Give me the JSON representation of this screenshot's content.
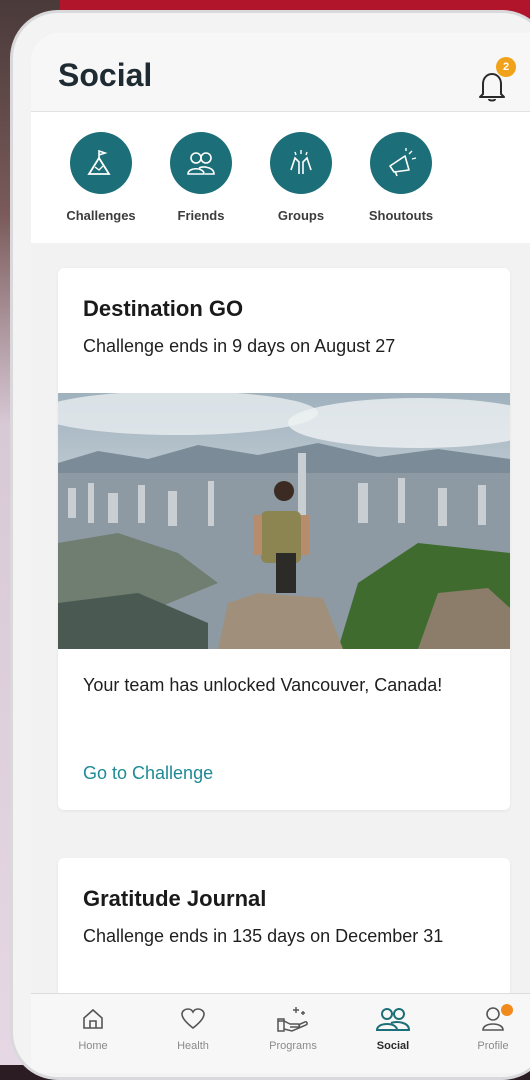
{
  "header": {
    "title": "Social",
    "notification_count": "2"
  },
  "quick_actions": [
    {
      "label": "Challenges",
      "icon": "mountain-flag-icon"
    },
    {
      "label": "Friends",
      "icon": "friends-icon"
    },
    {
      "label": "Groups",
      "icon": "high-five-icon"
    },
    {
      "label": "Shoutouts",
      "icon": "megaphone-icon"
    }
  ],
  "cards": [
    {
      "title": "Destination GO",
      "subtitle": "Challenge ends in 9 days on August 27",
      "body": "Your team has unlocked Vancouver, Canada!",
      "link": "Go to Challenge"
    },
    {
      "title": "Gratitude Journal",
      "subtitle": "Challenge ends in 135 days on December 31"
    }
  ],
  "tabs": [
    {
      "label": "Home",
      "icon": "home-icon"
    },
    {
      "label": "Health",
      "icon": "heart-icon"
    },
    {
      "label": "Programs",
      "icon": "hand-sparkle-icon"
    },
    {
      "label": "Social",
      "icon": "people-icon",
      "active": true
    },
    {
      "label": "Profile",
      "icon": "person-icon"
    }
  ],
  "colors": {
    "accent": "#1c6f78",
    "link": "#1e8a96",
    "badge": "#f0a21b"
  }
}
